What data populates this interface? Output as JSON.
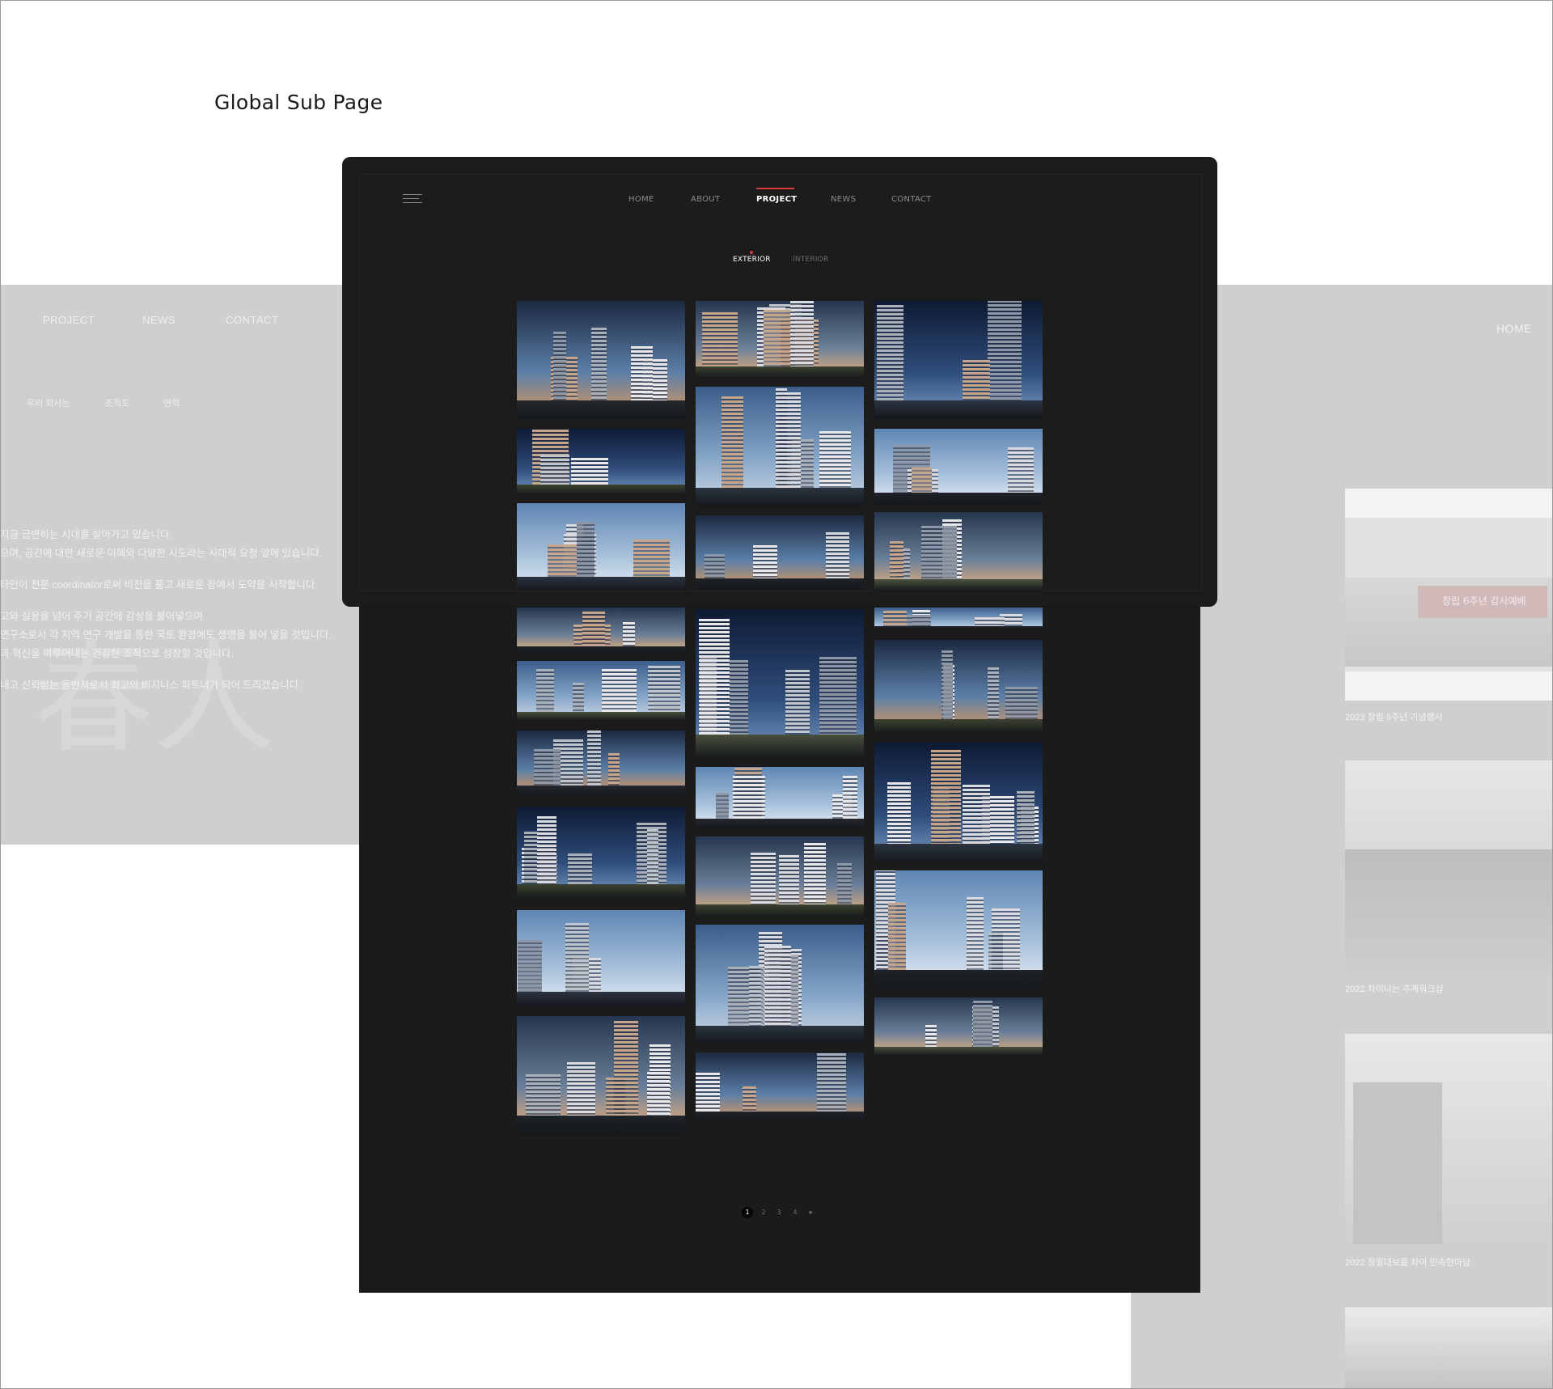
{
  "page": {
    "heading": "Global Sub Page"
  },
  "background_left": {
    "nav": [
      "PROJECT",
      "NEWS",
      "CONTACT"
    ],
    "subnav": [
      "우리 회사는",
      "조직도",
      "연혁"
    ],
    "body_lines": [
      "지금 급변하는 시대를 살아가고 있습니다.",
      "으며, 공간에 대한 새로운 이해와 다양한 시도라는 시대적 요청 앞에 있습니다.",
      "",
      "타인이 전문 coordinator로써 비전을 품고 새로운 장에서 도약을 시작합니다",
      "",
      "고와 실용을 넘어 주거 공간에 감성을 불어넣으며",
      "연구소로서 각 지역 연구 개발을 통한 국토 환경에도 생명을 불어 넣을 것입니다.",
      "과 혁신을 이루어내는 건강한 조직으로 성장할 것입니다.",
      "",
      "내고 신뢰받는 동반자로서 최고의 비지니스 파트너가 되어 드리겠습니다."
    ],
    "watermark": "春人"
  },
  "background_right": {
    "home_label": "HOME",
    "photos": [
      {
        "caption": "2023 창립 6주년 기념행사",
        "banner": "창립 6주년 감사예배"
      },
      {
        "caption": "2022 차이나는 추계워크샵"
      },
      {
        "caption": "2022 정월대보름 차이 민속한마당"
      },
      {
        "caption": ""
      }
    ]
  },
  "nav": {
    "items": [
      {
        "label": "HOME",
        "active": false
      },
      {
        "label": "ABOUT",
        "active": false
      },
      {
        "label": "PROJECT",
        "active": true
      },
      {
        "label": "NEWS",
        "active": false
      },
      {
        "label": "CONTACT",
        "active": false
      }
    ],
    "accent_color": "#d63a3a"
  },
  "tabs": [
    {
      "label": "EXTERIOR",
      "active": true
    },
    {
      "label": "INTERIOR",
      "active": false
    }
  ],
  "gallery": {
    "icon": "architecture-render-thumbnail",
    "columns": [
      [
        "tower-evening-street",
        "towers-sunset-panorama",
        "white-canopy-facade",
        "night-city-complex",
        "twin-tower-dusk",
        "towers-riverside",
        "tall-towers-day",
        "dusk-skyline",
        "aerial-mixed-use"
      ],
      [
        "curved-tower-night",
        "aerial-night-district",
        "arcade-entrance-night",
        "aerial-daylight-campus",
        "aerial-curved-towers",
        "tower-block-sunset",
        "tower-evening-street-2",
        "riverside-towers-day"
      ],
      [
        "tower-aerial-green",
        "terrace-rooftop-plaza",
        "white-office-block",
        "dark-strip",
        "twin-tower-dusk-2",
        "towers-sunset-hills",
        "tower-aerial-green-2",
        "towers-worms-eye"
      ]
    ]
  },
  "pagination": {
    "pages": [
      "1",
      "2",
      "3",
      "4"
    ],
    "current": "1",
    "next_label": "»"
  }
}
